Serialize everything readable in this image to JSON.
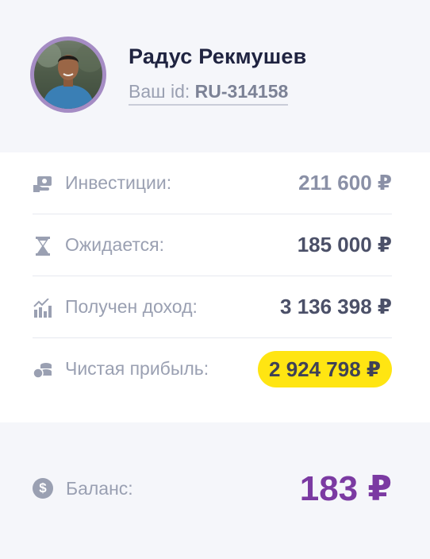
{
  "profile": {
    "name": "Радус Рекмушев",
    "id_label": "Ваш id:",
    "id_value": "RU-314158"
  },
  "stats": [
    {
      "icon": "money-hand-icon",
      "label": "Инвестиции:",
      "value": "211 600 ₽"
    },
    {
      "icon": "hourglass-icon",
      "label": "Ожидается:",
      "value": "185 000 ₽"
    },
    {
      "icon": "bar-chart-icon",
      "label": "Получен доход:",
      "value": "3 136 398 ₽"
    },
    {
      "icon": "coins-icon",
      "label": "Чистая прибыль:",
      "value": "2 924 798 ₽",
      "highlight_color": "#ffe512"
    }
  ],
  "balance": {
    "icon": "dollar-coin-icon",
    "icon_glyph": "$",
    "label": "Баланс:",
    "value": "183 ₽",
    "color": "#7b3aa2"
  }
}
